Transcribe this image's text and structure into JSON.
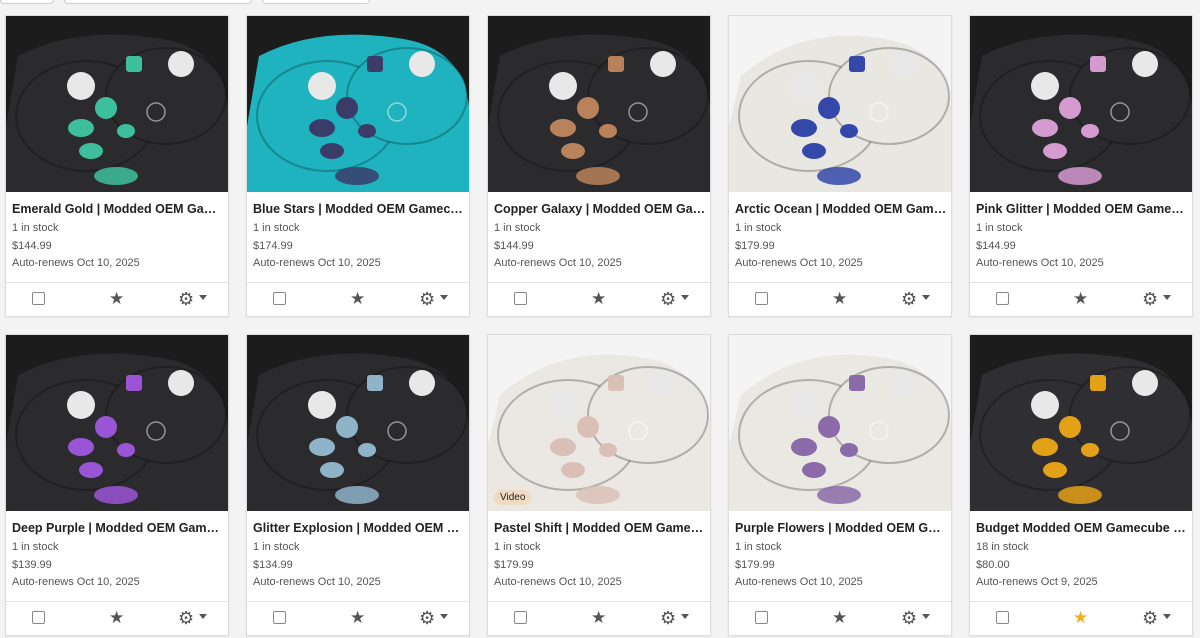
{
  "listings": [
    {
      "title": "Emerald Gold | Modded OEM Gamecube Controller",
      "stock": "1 in stock",
      "price": "$144.99",
      "renew": "Auto-renews Oct 10, 2025",
      "shell": "#2b2b2d",
      "btn": "#3dbf9e",
      "featured": false,
      "video": false,
      "gear_icon": "gear-icon",
      "star_icon": "star-icon"
    },
    {
      "title": "Blue Stars | Modded OEM Gamecube Controller",
      "stock": "1 in stock",
      "price": "$174.99",
      "renew": "Auto-renews Oct 10, 2025",
      "shell": "#1fb3bf",
      "btn": "#3b3b6a",
      "featured": false,
      "video": false,
      "gear_icon": "gear-icon",
      "star_icon": "star-icon"
    },
    {
      "title": "Copper Galaxy | Modded OEM Gamecube Controller",
      "stock": "1 in stock",
      "price": "$144.99",
      "renew": "Auto-renews Oct 10, 2025",
      "shell": "#2b2b2d",
      "btn": "#b9825a",
      "featured": false,
      "video": false,
      "gear_icon": "gear-icon",
      "star_icon": "star-icon"
    },
    {
      "title": "Arctic Ocean | Modded OEM Gamecube Controller",
      "stock": "1 in stock",
      "price": "$179.99",
      "renew": "Auto-renews Oct 10, 2025",
      "shell": "#e9e7e1",
      "btn": "#3348a8",
      "featured": false,
      "video": false,
      "gear_icon": "gear-icon",
      "star_icon": "star-icon"
    },
    {
      "title": "Pink Glitter | Modded OEM Gamecube Controller",
      "stock": "1 in stock",
      "price": "$144.99",
      "renew": "Auto-renews Oct 10, 2025",
      "shell": "#2b2b2d",
      "btn": "#d59ad0",
      "featured": false,
      "video": false,
      "gear_icon": "gear-icon",
      "star_icon": "star-icon"
    },
    {
      "title": "Deep Purple | Modded OEM Gamecube Controller",
      "stock": "1 in stock",
      "price": "$139.99",
      "renew": "Auto-renews Oct 10, 2025",
      "shell": "#2b2b2d",
      "btn": "#9a55d6",
      "featured": false,
      "video": false,
      "gear_icon": "gear-icon",
      "star_icon": "star-icon"
    },
    {
      "title": "Glitter Explosion | Modded OEM Gamecube Controller",
      "stock": "1 in stock",
      "price": "$134.99",
      "renew": "Auto-renews Oct 10, 2025",
      "shell": "#2b2b2d",
      "btn": "#8fb3c9",
      "featured": false,
      "video": false,
      "gear_icon": "gear-icon",
      "star_icon": "star-icon"
    },
    {
      "title": "Pastel Shift | Modded OEM Gamecube Controller",
      "stock": "1 in stock",
      "price": "$179.99",
      "renew": "Auto-renews Oct 10, 2025",
      "shell": "#ebe8e4",
      "btn": "#d9bfb6",
      "featured": false,
      "video": true,
      "video_label": "Video",
      "gear_icon": "gear-icon",
      "star_icon": "star-icon"
    },
    {
      "title": "Purple Flowers | Modded OEM Gamecube Controller",
      "stock": "1 in stock",
      "price": "$179.99",
      "renew": "Auto-renews Oct 10, 2025",
      "shell": "#eae8e3",
      "btn": "#8a6aa8",
      "featured": false,
      "video": false,
      "gear_icon": "gear-icon",
      "star_icon": "star-icon"
    },
    {
      "title": "Budget Modded OEM Gamecube Controller",
      "stock": "18 in stock",
      "price": "$80.00",
      "renew": "Auto-renews Oct 9, 2025",
      "shell": "#2f2f33",
      "btn": "#e3a118",
      "featured": true,
      "video": false,
      "gear_icon": "gear-icon",
      "star_icon": "star-icon"
    }
  ]
}
